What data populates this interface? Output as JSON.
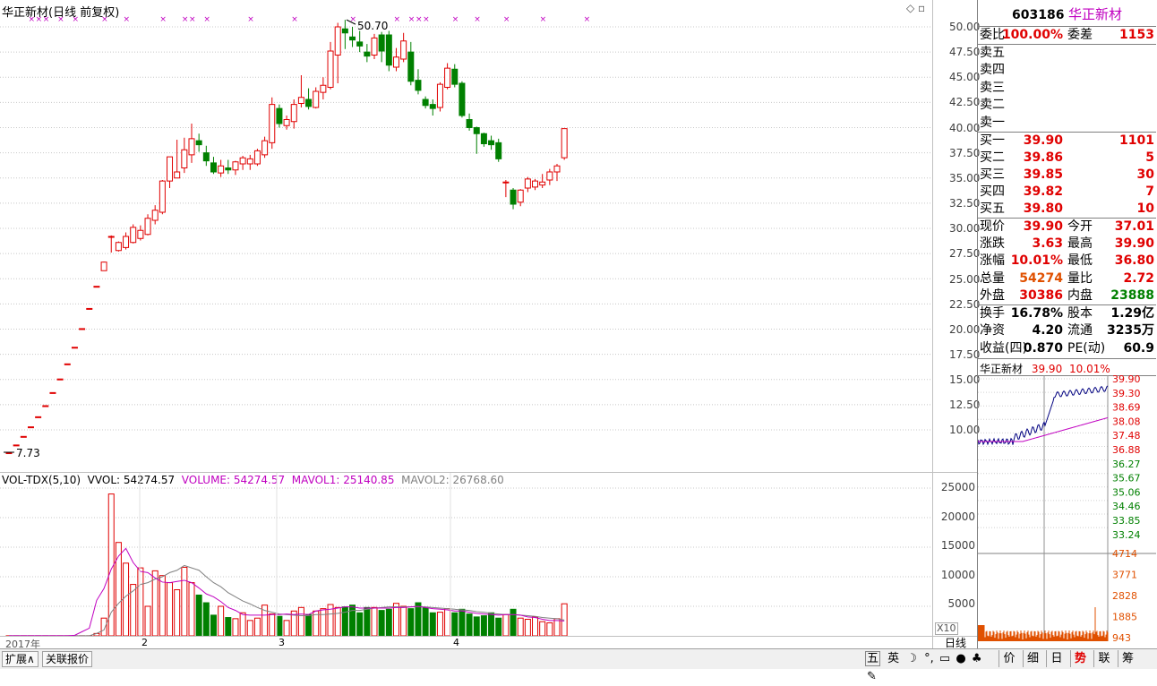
{
  "chart": {
    "title": "华正新材(日线 前复权)",
    "max_label": "50.70",
    "min_label": "7.73",
    "price_ticks": [
      "50.00",
      "47.50",
      "45.00",
      "42.50",
      "40.00",
      "37.50",
      "35.00",
      "32.50",
      "30.00",
      "27.50",
      "25.00",
      "22.50",
      "20.00",
      "17.50",
      "15.00",
      "12.50",
      "10.00"
    ],
    "vol_indicator": "VOL-TDX(5,10)",
    "vvol": "VVOL: 54274.57",
    "volume": "VOLUME: 54274.57",
    "mavol1": "MAVOL1: 25140.85",
    "mavol2": "MAVOL2: 26768.60",
    "vol_ticks": [
      "25000",
      "20000",
      "15000",
      "10000",
      "5000"
    ],
    "vol_unit": "X10",
    "date_labels": [
      "2017年",
      "2",
      "3",
      "4"
    ],
    "period": "日线"
  },
  "chart_data": {
    "type": "candlestick",
    "title": "华正新材(日线 前复权)",
    "ylim": [
      7.0,
      51.5
    ],
    "candles": [
      {
        "o": 7.73,
        "h": 7.73,
        "l": 7.73,
        "c": 7.73
      },
      {
        "o": 8.5,
        "h": 8.5,
        "l": 8.5,
        "c": 8.5
      },
      {
        "o": 9.35,
        "h": 9.35,
        "l": 9.35,
        "c": 9.35
      },
      {
        "o": 10.3,
        "h": 10.3,
        "l": 10.3,
        "c": 10.3
      },
      {
        "o": 11.3,
        "h": 11.3,
        "l": 11.3,
        "c": 11.3
      },
      {
        "o": 12.4,
        "h": 12.4,
        "l": 12.4,
        "c": 12.4
      },
      {
        "o": 13.7,
        "h": 13.7,
        "l": 13.7,
        "c": 13.7
      },
      {
        "o": 15.05,
        "h": 15.05,
        "l": 15.05,
        "c": 15.05
      },
      {
        "o": 16.55,
        "h": 16.55,
        "l": 16.55,
        "c": 16.55
      },
      {
        "o": 18.2,
        "h": 18.2,
        "l": 18.2,
        "c": 18.2
      },
      {
        "o": 20.05,
        "h": 20.05,
        "l": 20.05,
        "c": 20.05
      },
      {
        "o": 22.05,
        "h": 22.05,
        "l": 22.05,
        "c": 22.05
      },
      {
        "o": 24.25,
        "h": 24.25,
        "l": 24.25,
        "c": 24.25
      },
      {
        "o": 25.8,
        "h": 26.7,
        "l": 25.8,
        "c": 26.65
      },
      {
        "o": 29.2,
        "h": 29.3,
        "l": 27.6,
        "c": 29.2
      },
      {
        "o": 27.8,
        "h": 28.7,
        "l": 27.7,
        "c": 28.6
      },
      {
        "o": 28.1,
        "h": 29.6,
        "l": 27.9,
        "c": 29.2
      },
      {
        "o": 28.6,
        "h": 30.4,
        "l": 28.5,
        "c": 30.1
      },
      {
        "o": 29.0,
        "h": 30.3,
        "l": 28.8,
        "c": 29.8
      },
      {
        "o": 29.4,
        "h": 31.4,
        "l": 29.3,
        "c": 31.0
      },
      {
        "o": 30.8,
        "h": 32.3,
        "l": 30.4,
        "c": 31.8
      },
      {
        "o": 31.6,
        "h": 34.8,
        "l": 31.4,
        "c": 34.7
      },
      {
        "o": 34.7,
        "h": 36.6,
        "l": 34.0,
        "c": 37.1
      },
      {
        "o": 35.0,
        "h": 38.8,
        "l": 35.0,
        "c": 35.6
      },
      {
        "o": 36.0,
        "h": 39.0,
        "l": 35.5,
        "c": 37.8
      },
      {
        "o": 37.3,
        "h": 40.4,
        "l": 36.5,
        "c": 38.9
      },
      {
        "o": 38.7,
        "h": 39.4,
        "l": 37.6,
        "c": 38.3
      },
      {
        "o": 37.5,
        "h": 38.2,
        "l": 36.2,
        "c": 36.7
      },
      {
        "o": 36.5,
        "h": 37.1,
        "l": 35.4,
        "c": 35.6
      },
      {
        "o": 35.5,
        "h": 36.8,
        "l": 35.1,
        "c": 36.2
      },
      {
        "o": 36.0,
        "h": 36.8,
        "l": 35.4,
        "c": 35.8
      },
      {
        "o": 35.8,
        "h": 36.7,
        "l": 35.3,
        "c": 36.6
      },
      {
        "o": 36.4,
        "h": 37.2,
        "l": 35.8,
        "c": 37.0
      },
      {
        "o": 36.4,
        "h": 37.3,
        "l": 35.8,
        "c": 36.9
      },
      {
        "o": 36.4,
        "h": 37.9,
        "l": 36.2,
        "c": 37.7
      },
      {
        "o": 37.3,
        "h": 39.1,
        "l": 37.0,
        "c": 38.7
      },
      {
        "o": 38.5,
        "h": 43.0,
        "l": 37.9,
        "c": 42.3
      },
      {
        "o": 41.9,
        "h": 42.3,
        "l": 40.0,
        "c": 40.4
      },
      {
        "o": 40.2,
        "h": 41.2,
        "l": 39.8,
        "c": 40.8
      },
      {
        "o": 40.6,
        "h": 42.8,
        "l": 39.9,
        "c": 42.3
      },
      {
        "o": 42.4,
        "h": 45.2,
        "l": 42.0,
        "c": 43.0
      },
      {
        "o": 42.8,
        "h": 43.9,
        "l": 41.8,
        "c": 42.1
      },
      {
        "o": 42.0,
        "h": 44.0,
        "l": 41.9,
        "c": 43.6
      },
      {
        "o": 43.5,
        "h": 45.0,
        "l": 42.8,
        "c": 44.2
      },
      {
        "o": 44.0,
        "h": 48.5,
        "l": 43.8,
        "c": 47.6
      },
      {
        "o": 47.2,
        "h": 50.4,
        "l": 44.4,
        "c": 50.0
      },
      {
        "o": 49.8,
        "h": 50.7,
        "l": 47.8,
        "c": 49.4
      },
      {
        "o": 49.0,
        "h": 50.0,
        "l": 48.0,
        "c": 48.7
      },
      {
        "o": 48.5,
        "h": 49.6,
        "l": 47.5,
        "c": 48.1
      },
      {
        "o": 47.5,
        "h": 48.3,
        "l": 46.5,
        "c": 47.1
      },
      {
        "o": 47.2,
        "h": 49.3,
        "l": 46.8,
        "c": 48.9
      },
      {
        "o": 49.2,
        "h": 49.5,
        "l": 46.5,
        "c": 47.6
      },
      {
        "o": 49.2,
        "h": 49.6,
        "l": 45.6,
        "c": 46.2
      },
      {
        "o": 46.0,
        "h": 47.9,
        "l": 45.6,
        "c": 47.0
      },
      {
        "o": 46.8,
        "h": 49.4,
        "l": 46.5,
        "c": 48.6
      },
      {
        "o": 47.5,
        "h": 48.5,
        "l": 44.2,
        "c": 44.6
      },
      {
        "o": 44.7,
        "h": 45.8,
        "l": 43.3,
        "c": 43.7
      },
      {
        "o": 42.8,
        "h": 43.1,
        "l": 41.9,
        "c": 42.2
      },
      {
        "o": 42.3,
        "h": 42.8,
        "l": 41.2,
        "c": 41.9
      },
      {
        "o": 42.0,
        "h": 44.5,
        "l": 41.6,
        "c": 44.3
      },
      {
        "o": 44.0,
        "h": 46.4,
        "l": 43.8,
        "c": 45.9
      },
      {
        "o": 45.8,
        "h": 46.3,
        "l": 44.0,
        "c": 44.3
      },
      {
        "o": 44.4,
        "h": 44.6,
        "l": 41.0,
        "c": 41.2
      },
      {
        "o": 40.8,
        "h": 41.4,
        "l": 39.7,
        "c": 40.0
      },
      {
        "o": 40.0,
        "h": 40.1,
        "l": 37.4,
        "c": 39.4
      },
      {
        "o": 39.4,
        "h": 39.5,
        "l": 38.1,
        "c": 38.4
      },
      {
        "o": 38.7,
        "h": 39.2,
        "l": 37.8,
        "c": 38.3
      },
      {
        "o": 38.5,
        "h": 38.9,
        "l": 36.6,
        "c": 36.9
      },
      {
        "o": 34.6,
        "h": 34.8,
        "l": 33.1,
        "c": 34.6
      },
      {
        "o": 33.8,
        "h": 34.0,
        "l": 31.9,
        "c": 32.4
      },
      {
        "o": 32.6,
        "h": 33.9,
        "l": 32.2,
        "c": 33.8
      },
      {
        "o": 34.0,
        "h": 35.1,
        "l": 33.6,
        "c": 34.9
      },
      {
        "o": 34.1,
        "h": 34.9,
        "l": 33.8,
        "c": 34.7
      },
      {
        "o": 34.3,
        "h": 35.4,
        "l": 34.0,
        "c": 34.6
      },
      {
        "o": 34.8,
        "h": 35.9,
        "l": 34.3,
        "c": 35.6
      },
      {
        "o": 35.6,
        "h": 36.4,
        "l": 34.7,
        "c": 36.2
      },
      {
        "o": 37.01,
        "h": 39.9,
        "l": 36.8,
        "c": 39.9
      }
    ],
    "volumes": [
      20,
      20,
      20,
      20,
      20,
      20,
      20,
      20,
      20,
      20,
      20,
      20,
      400,
      3000,
      24000,
      15800,
      12300,
      8700,
      11500,
      5000,
      11000,
      10200,
      9000,
      7800,
      11600,
      9000,
      6900,
      5600,
      3500,
      5000,
      3100,
      2900,
      3900,
      2600,
      3000,
      5200,
      3700,
      3300,
      2600,
      4200,
      4800,
      3600,
      4200,
      4600,
      5300,
      4800,
      4900,
      5200,
      3900,
      4800,
      4800,
      4300,
      4500,
      5500,
      5000,
      4600,
      5600,
      4700,
      3900,
      4000,
      4600,
      3900,
      4500,
      3700,
      3200,
      3400,
      3900,
      3000,
      3600,
      4500,
      3000,
      2800,
      3200,
      2400,
      2200,
      2900,
      5427
    ],
    "mavol1_series": [
      20,
      20,
      20,
      20,
      20,
      20,
      20,
      20,
      20,
      100,
      700,
      1300,
      6000,
      8000,
      11300,
      13500,
      14800,
      12400,
      10900,
      10700,
      9800,
      9100,
      9000,
      9200,
      9400,
      9000,
      8100,
      7100,
      6600,
      5800,
      4800,
      4300,
      3600,
      3500,
      3500,
      3500,
      3600,
      3600,
      3700,
      3600,
      3700,
      3600,
      4200,
      4400,
      4500,
      4700,
      4900,
      4900,
      4700,
      4700,
      4700,
      4700,
      4700,
      4800,
      4800,
      4900,
      5000,
      4800,
      4600,
      4500,
      4400,
      4200,
      4200,
      4000,
      3800,
      3700,
      3600,
      3500,
      3600,
      3600,
      3500,
      3200,
      3100,
      2800,
      2600,
      2600,
      2512
    ],
    "mavol2_series": [
      20,
      20,
      20,
      20,
      20,
      20,
      20,
      20,
      20,
      20,
      20,
      20,
      400,
      1000,
      4000,
      5500,
      6700,
      7600,
      8700,
      9000,
      9600,
      10000,
      10700,
      11100,
      11900,
      11500,
      11100,
      10000,
      9000,
      8300,
      7300,
      6600,
      5900,
      5400,
      4800,
      4300,
      4000,
      3700,
      3600,
      3500,
      3400,
      3400,
      3600,
      3600,
      3700,
      3800,
      4000,
      4300,
      4300,
      4500,
      4700,
      4800,
      4900,
      4900,
      4900,
      4900,
      4900,
      4900,
      4800,
      4700,
      4600,
      4500,
      4400,
      4300,
      4100,
      4000,
      3800,
      3700,
      3600,
      3600,
      3500,
      3400,
      3300,
      3100,
      3000,
      2900,
      2677
    ]
  },
  "quote": {
    "code": "603186",
    "name": "华正新材",
    "weibi_label": "委比",
    "weibi": "100.00%",
    "weicha_label": "委差",
    "weicha": "1153",
    "sell": [
      {
        "label": "卖五",
        "price": "",
        "vol": ""
      },
      {
        "label": "卖四",
        "price": "",
        "vol": ""
      },
      {
        "label": "卖三",
        "price": "",
        "vol": ""
      },
      {
        "label": "卖二",
        "price": "",
        "vol": ""
      },
      {
        "label": "卖一",
        "price": "",
        "vol": ""
      }
    ],
    "buy": [
      {
        "label": "买一",
        "price": "39.90",
        "vol": "1101"
      },
      {
        "label": "买二",
        "price": "39.86",
        "vol": "5"
      },
      {
        "label": "买三",
        "price": "39.85",
        "vol": "30"
      },
      {
        "label": "买四",
        "price": "39.82",
        "vol": "7"
      },
      {
        "label": "买五",
        "price": "39.80",
        "vol": "10"
      }
    ],
    "stats1": [
      {
        "l1": "现价",
        "v1": "39.90",
        "l2": "今开",
        "v2": "37.01"
      },
      {
        "l1": "涨跌",
        "v1": "3.63",
        "l2": "最高",
        "v2": "39.90"
      },
      {
        "l1": "涨幅",
        "v1": "10.01%",
        "l2": "最低",
        "v2": "36.80"
      },
      {
        "l1": "总量",
        "v1": "54274",
        "l2": "量比",
        "v2": "2.72"
      },
      {
        "l1": "外盘",
        "v1": "30386",
        "l2": "内盘",
        "v2": "23888"
      }
    ],
    "stats2": [
      {
        "l1": "换手",
        "v1": "16.78%",
        "l2": "股本",
        "v2": "1.29亿"
      },
      {
        "l1": "净资",
        "v1": "4.20",
        "l2": "流通",
        "v2": "3235万"
      },
      {
        "l1": "收益(四)",
        "v1": "0.870",
        "l2": "PE(动)",
        "v2": "60.9"
      }
    ]
  },
  "mini_chart": {
    "name": "华正新材",
    "price": "39.90",
    "pct": "10.01%",
    "price_ticks": [
      "39.90",
      "39.30",
      "38.69",
      "38.08",
      "37.48",
      "36.88",
      "36.27",
      "35.67",
      "35.06",
      "34.46",
      "33.85",
      "33.24"
    ],
    "vol_ticks": [
      "4714",
      "3771",
      "2828",
      "1885",
      "943"
    ]
  },
  "bottom": {
    "tab1": "扩展∧",
    "tab2": "关联报价",
    "right_tabs": [
      "价",
      "细",
      "日",
      "势",
      "联",
      "筹"
    ],
    "icons": [
      "五",
      "英"
    ]
  }
}
